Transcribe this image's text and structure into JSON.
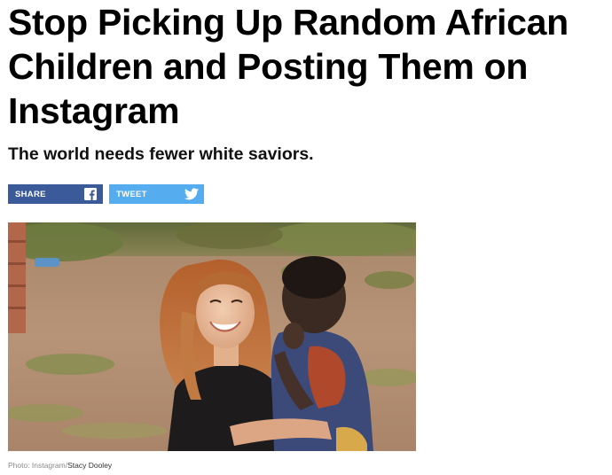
{
  "article": {
    "headline": "Stop Picking Up Random African Children and Posting Them on Instagram",
    "dek": "The world needs fewer white saviors."
  },
  "share": {
    "facebook_label": "SHARE",
    "twitter_label": "TWEET",
    "facebook_icon": "facebook-icon",
    "twitter_icon": "twitter-bird-icon",
    "colors": {
      "facebook": "#3b5a9a",
      "twitter": "#55acee"
    }
  },
  "photo": {
    "alt": "Photo: Instagram/Stacy Dooley"
  },
  "caption": {
    "prefix": "Photo: Instagram/",
    "name": "Stacy Dooley"
  }
}
